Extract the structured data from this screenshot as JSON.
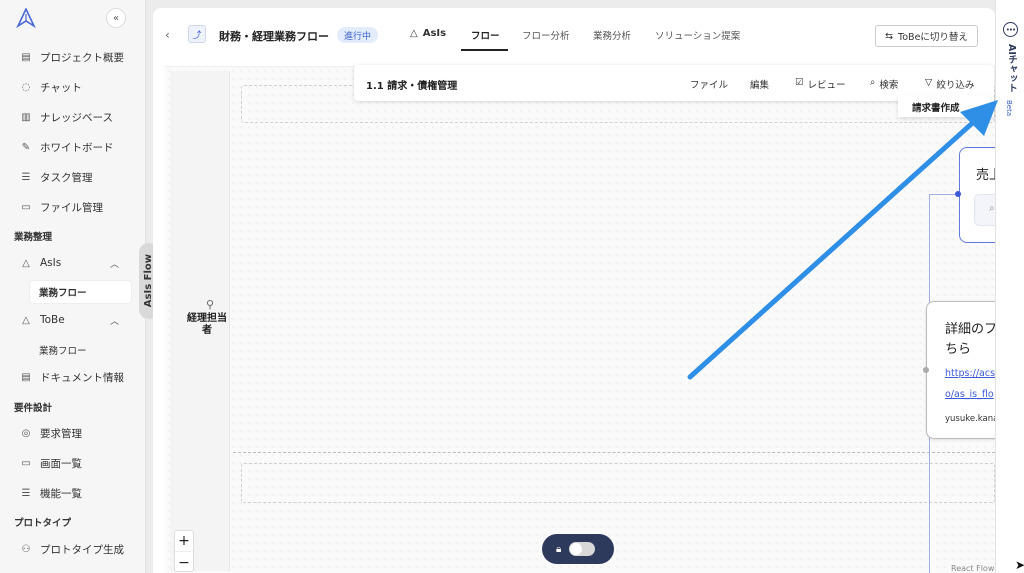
{
  "sidebar": {
    "collapse_glyph": "«",
    "items": [
      {
        "label": "プロジェクト概要",
        "icon": "clipboard-icon"
      },
      {
        "label": "チャット",
        "icon": "chat-icon"
      },
      {
        "label": "ナレッジベース",
        "icon": "book-icon"
      },
      {
        "label": "ホワイトボード",
        "icon": "pen-icon"
      },
      {
        "label": "タスク管理",
        "icon": "list-icon"
      },
      {
        "label": "ファイル管理",
        "icon": "folder-icon"
      }
    ],
    "section_business": "業務整理",
    "asis": {
      "label": "AsIs",
      "sub": "業務フロー"
    },
    "tobe": {
      "label": "ToBe",
      "sub": "業務フロー"
    },
    "document_info": "ドキュメント情報",
    "section_requirements": "要件設計",
    "requirements": "要求管理",
    "screens": "画面一覧",
    "functions": "機能一覧",
    "section_prototype": "プロトタイプ",
    "prototype_gen": "プロトタイプ生成",
    "asis_flow_tab": "AsIs Flow"
  },
  "header": {
    "title": "財務・経理業務フロー",
    "status": "進行中",
    "asis": "AsIs",
    "tabs": [
      "フロー",
      "フロー分析",
      "業務分析",
      "ソリューション提案"
    ],
    "switch_button": "ToBeに切り替え"
  },
  "toolbar": {
    "title": "1.1 請求・債権管理",
    "file": "ファイル",
    "edit": "編集",
    "review": "レビュー",
    "search": "検索",
    "filter": "絞り込み",
    "dropdown_item": "請求書作成"
  },
  "canvas": {
    "lane_name": "経理担当者",
    "node_sale": {
      "title": "売上"
    },
    "node_detail": {
      "title_line1": "詳細のフ",
      "title_line2": "ちら",
      "link_line1": "https://acs",
      "link_line2": "o/as_is_flo",
      "owner": "yusuke.kana"
    },
    "zoom_in": "+",
    "zoom_out": "−",
    "attribution": "React Flow"
  },
  "right_panel": {
    "chat_label": "AIチャット",
    "beta": "Beta"
  },
  "colors": {
    "accent": "#3b5bd6",
    "dark": "#2e3a5c",
    "arrow": "#2f8ee6"
  }
}
